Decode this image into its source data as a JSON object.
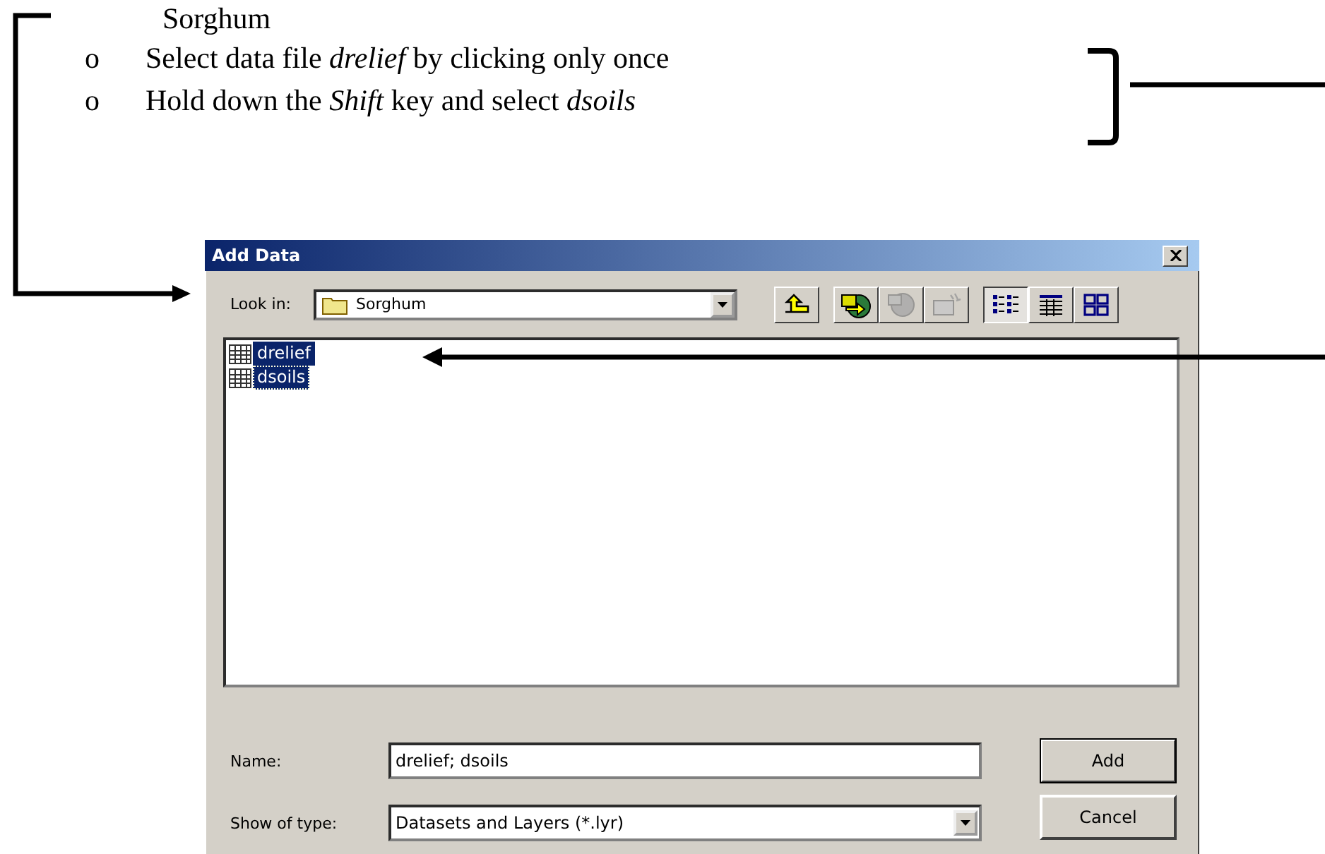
{
  "document": {
    "heading": "Sorghum",
    "bullets": [
      {
        "marker": "o",
        "text": "Select data file *drelief* by clicking only once"
      },
      {
        "marker": "o",
        "text": "Hold down the *Shift* key and select *dsoils*"
      }
    ]
  },
  "dialog": {
    "title": "Add Data",
    "look_in": {
      "label": "Look in:",
      "value": "Sorghum"
    },
    "toolbar": [
      {
        "kind": "up",
        "disabled": false,
        "selected": false
      },
      {
        "kind": "connect",
        "disabled": false,
        "selected": false
      },
      {
        "kind": "disconnect",
        "disabled": true,
        "selected": false
      },
      {
        "kind": "new",
        "disabled": true,
        "selected": false
      },
      {
        "kind": "list",
        "disabled": false,
        "selected": true
      },
      {
        "kind": "details",
        "disabled": false,
        "selected": false
      },
      {
        "kind": "thumbnails",
        "disabled": false,
        "selected": false
      }
    ],
    "files": [
      {
        "name": "drelief",
        "selected": true,
        "focused": false
      },
      {
        "name": "dsoils",
        "selected": true,
        "focused": true
      }
    ],
    "name_field": {
      "label": "Name:",
      "value": "drelief; dsoils"
    },
    "type_field": {
      "label": "Show of type:",
      "value": "Datasets and Layers (*.lyr)"
    },
    "buttons": [
      {
        "label": "Add",
        "default": true
      },
      {
        "label": "Cancel",
        "default": false
      }
    ]
  }
}
